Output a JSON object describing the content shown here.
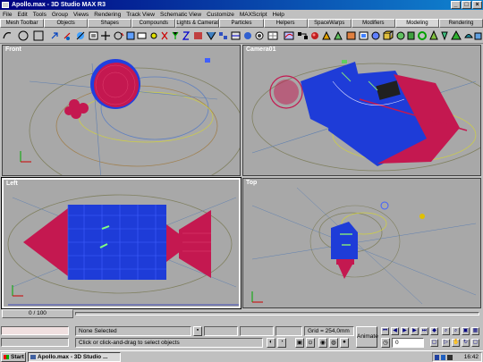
{
  "window": {
    "title": "Apollo.max - 3D Studio MAX R3"
  },
  "menu": [
    "File",
    "Edit",
    "Tools",
    "Group",
    "Views",
    "Rendering",
    "Track View",
    "Schematic View",
    "Customize",
    "MAXScript",
    "Help"
  ],
  "tabs": [
    "Mesh Toolbar",
    "Objects",
    "Shapes",
    "Compounds",
    "Lights & Cameras",
    "Particles",
    "Helpers",
    "SpaceWarps",
    "Modifiers",
    "Modeling",
    "Rendering"
  ],
  "active_tab": "Modeling",
  "viewports": {
    "front": {
      "label": "Front"
    },
    "camera": {
      "label": "Camera01"
    },
    "left": {
      "label": "Left"
    },
    "top": {
      "label": "Top"
    }
  },
  "timeline": {
    "frame_label": "0 / 100"
  },
  "status": {
    "selection": "None Selected",
    "prompt": "Click or click-and-drag to select objects",
    "grid": "Grid = 254,0mm",
    "animate": "Animate",
    "frame_field": "0"
  },
  "taskbar": {
    "start": "Start",
    "task": "Apollo.max - 3D Studio ...",
    "clock": "16:42"
  },
  "colors": {
    "mesh_blue": "#1e3cd8",
    "mesh_red": "#c41850",
    "viewport_bg": "#a8a8a8",
    "title_bar": "#000080"
  }
}
